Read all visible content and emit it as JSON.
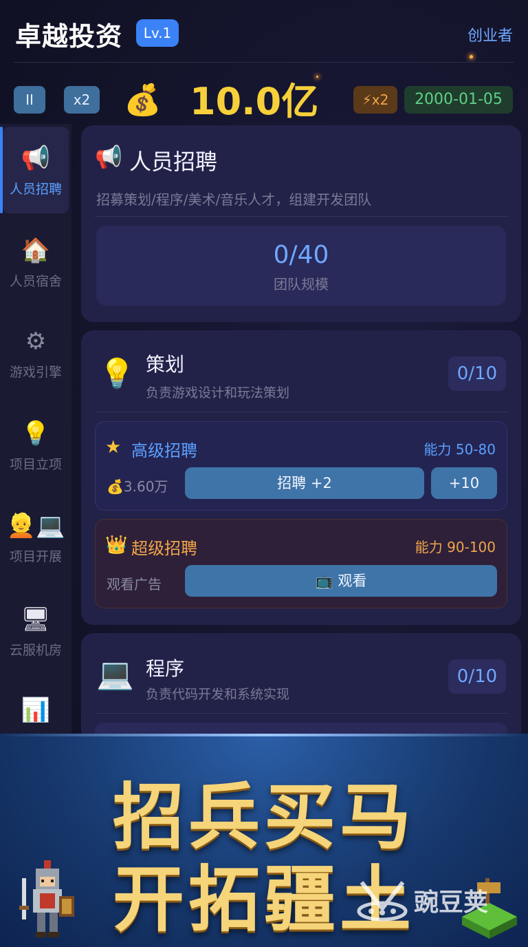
{
  "header": {
    "title": "卓越投资",
    "level": "Lv.1",
    "role": "创业者"
  },
  "status": {
    "pause_icon": "pause-icon",
    "pause_label": "II",
    "speed": "x2",
    "money_icon": "money-bag-icon",
    "money": "10.0亿",
    "boost": "⚡x2",
    "date": "2000-01-05"
  },
  "sidebar": {
    "items": [
      {
        "icon": "megaphone-icon",
        "label": "人员招聘",
        "active": true
      },
      {
        "icon": "house-icon",
        "label": "人员宿舍"
      },
      {
        "icon": "gear-icon",
        "label": "游戏引擎"
      },
      {
        "icon": "lightbulb-icon",
        "label": "项目立项"
      },
      {
        "icon": "worker-laptop-icon",
        "label": "项目开展"
      },
      {
        "icon": "computer-icon",
        "label": "云服机房"
      },
      {
        "icon": "bar-chart-icon",
        "label": ""
      }
    ]
  },
  "recruit": {
    "title": "人员招聘",
    "desc": "招募策划/程序/美术/音乐人才，组建开发团队",
    "team_value": "0/40",
    "team_label": "团队规模"
  },
  "planning": {
    "title": "策划",
    "desc": "负责游戏设计和玩法策划",
    "count": "0/10",
    "advanced": {
      "title": "高级招聘",
      "ability": "能力 50-80",
      "cost": "💰3.60万",
      "hire_label": "招聘 +2",
      "hire10_label": "+10"
    },
    "super": {
      "title": "超级招聘",
      "ability": "能力 90-100",
      "cost": "观看广告",
      "watch_label": "📺 观看"
    }
  },
  "programming": {
    "title": "程序",
    "desc": "负责代码开发和系统实现",
    "count": "0/10"
  },
  "promo": {
    "line1": "招兵买马",
    "line2": "开拓疆土",
    "watermark": "豌豆荚"
  },
  "colors": {
    "accent": "#3b82f6",
    "money": "#f6d03a",
    "date_green": "#5fd08a",
    "super_orange": "#f2a54a"
  }
}
